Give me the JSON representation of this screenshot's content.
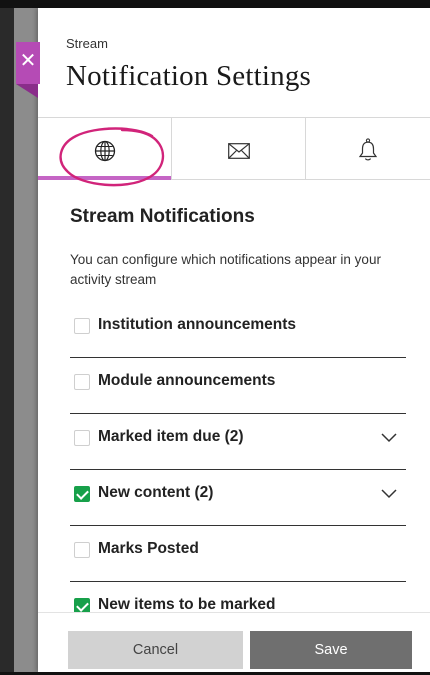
{
  "header": {
    "breadcrumb": "Stream",
    "title": "Notification Settings"
  },
  "close": {
    "icon": "close-icon",
    "accent": "#b54bb5"
  },
  "tabs": [
    {
      "name": "globe-icon",
      "active": true
    },
    {
      "name": "envelope-icon",
      "active": false
    },
    {
      "name": "bell-icon",
      "active": false
    }
  ],
  "section": {
    "title": "Stream Notifications",
    "description": "You can configure which notifications appear in your activity stream"
  },
  "options": [
    {
      "label": "Institution announcements",
      "checked": false,
      "expandable": false
    },
    {
      "label": "Module announcements",
      "checked": false,
      "expandable": false
    },
    {
      "label": "Marked item due (2)",
      "checked": false,
      "expandable": true
    },
    {
      "label": "New content (2)",
      "checked": true,
      "expandable": true
    },
    {
      "label": "Marks Posted",
      "checked": false,
      "expandable": false
    },
    {
      "label": "New items to be marked",
      "checked": true,
      "expandable": false
    }
  ],
  "footer": {
    "cancel_label": "Cancel",
    "save_label": "Save"
  },
  "colors": {
    "active_tab": "#c565c5",
    "checkbox_checked": "#17a04a",
    "annotation": "#d1247a"
  }
}
